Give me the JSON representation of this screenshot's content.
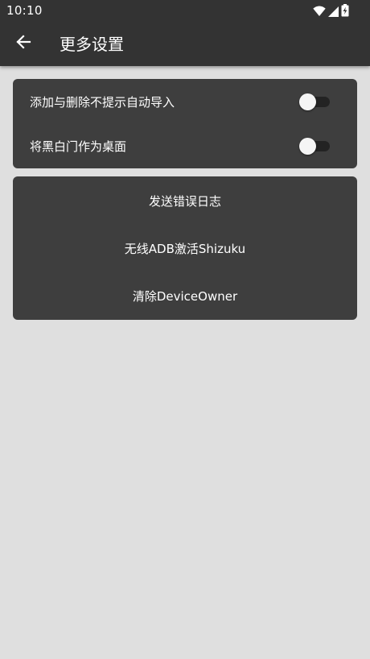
{
  "status_bar": {
    "time": "10:10",
    "icons": [
      "wifi-icon",
      "cellular-signal-icon",
      "battery-charging-icon"
    ]
  },
  "toolbar": {
    "back_icon": "arrow-back-icon",
    "title": "更多设置"
  },
  "settings": [
    {
      "label": "添加与删除不提示自动导入",
      "enabled": false
    },
    {
      "label": "将黑白门作为桌面",
      "enabled": false
    }
  ],
  "actions": [
    {
      "label": "发送错误日志"
    },
    {
      "label": "无线ADB激活Shizuku"
    },
    {
      "label": "清除DeviceOwner"
    }
  ],
  "colors": {
    "appbar": "#333333",
    "background": "#dfdfdf",
    "card": "#3e3e3e",
    "text": "#ffffff",
    "switch_track_off": "#232323",
    "switch_thumb_off": "#f5f5f5"
  }
}
